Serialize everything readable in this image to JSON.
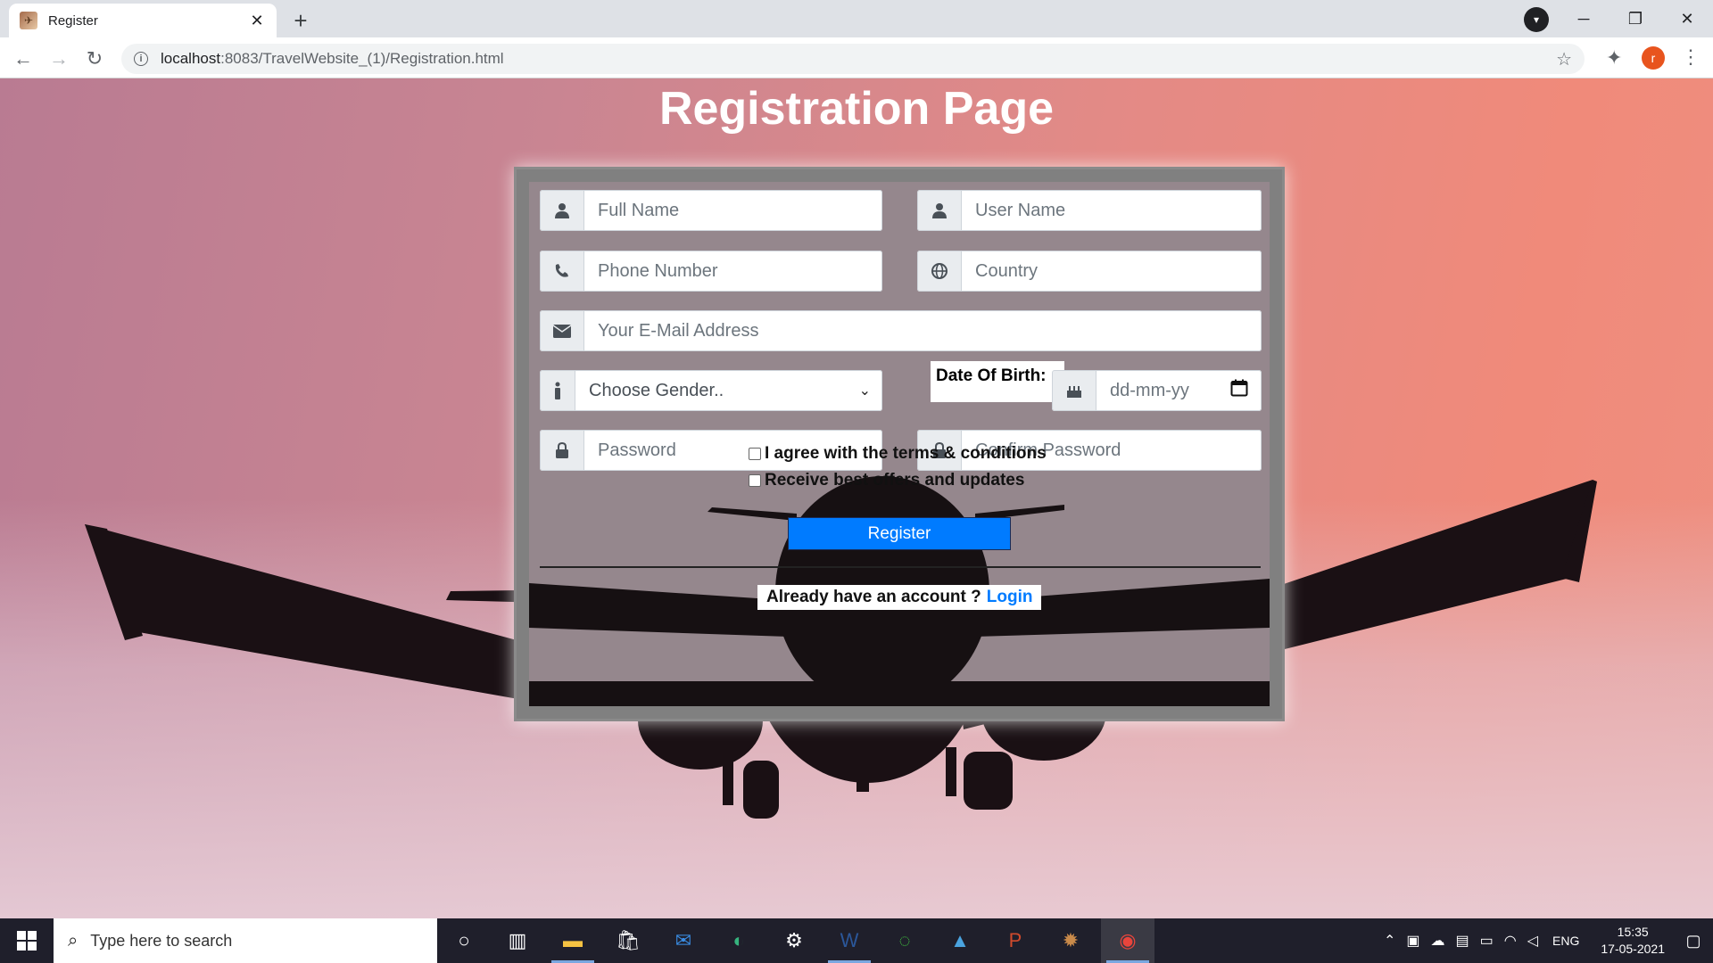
{
  "browser": {
    "tab_title": "Register",
    "tab_close": "✕",
    "new_tab": "+",
    "url_host": "localhost",
    "url_rest": ":8083/TravelWebsite_(1)/Registration.html",
    "avatar_letter": "r"
  },
  "page": {
    "title": "Registration Page"
  },
  "form": {
    "full_name_placeholder": "Full Name",
    "user_name_placeholder": "User Name",
    "phone_placeholder": "Phone Number",
    "country_placeholder": "Country",
    "email_placeholder": "Your E-Mail Address",
    "gender_selected": "Choose Gender..",
    "dob_label": "Date Of Birth:",
    "dob_placeholder": "dd-mm-yy",
    "password_placeholder": "Password",
    "confirm_password_placeholder": "Confirm Password",
    "terms_label": "I agree with the terms & conditions",
    "offers_label": "Receive best offers and updates",
    "register_label": "Register",
    "login_prompt": "Already have an account ?",
    "login_link": "Login"
  },
  "taskbar": {
    "search_placeholder": "Type here to search",
    "language": "ENG",
    "time": "15:35",
    "date": "17-05-2021"
  }
}
